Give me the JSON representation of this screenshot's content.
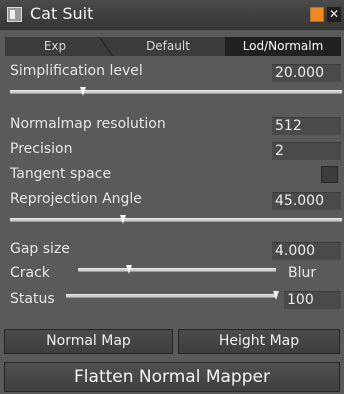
{
  "window": {
    "title": "Cat Suit",
    "min_color": "#ef8a1e",
    "close_glyph": "✕"
  },
  "tabs": [
    {
      "label": "Exp",
      "active": false
    },
    {
      "label": "Default",
      "active": false
    },
    {
      "label": "Lod/Normalm",
      "active": true
    }
  ],
  "params": {
    "simplification_label": "Simplification level",
    "simplification_value": "20.000",
    "normalmap_label": "Normalmap resolution",
    "normalmap_value": "512",
    "precision_label": "Precision",
    "precision_value": "2",
    "tangent_label": "Tangent space",
    "tangent_checked": false,
    "reprojection_label": "Reprojection Angle",
    "reprojection_value": "45.000",
    "gap_label": "Gap size",
    "gap_value": "4.000",
    "crack_label": "Crack",
    "blur_label": "Blur",
    "status_label": "Status",
    "status_value": "100"
  },
  "sliders": {
    "simplification_fraction": 0.22,
    "reprojection_fraction": 0.34,
    "crack_blur_fraction": 0.26,
    "status_fraction": 1.0
  },
  "buttons": {
    "normal_map": "Normal Map",
    "height_map": "Height Map",
    "flatten": "Flatten Normal Mapper"
  }
}
